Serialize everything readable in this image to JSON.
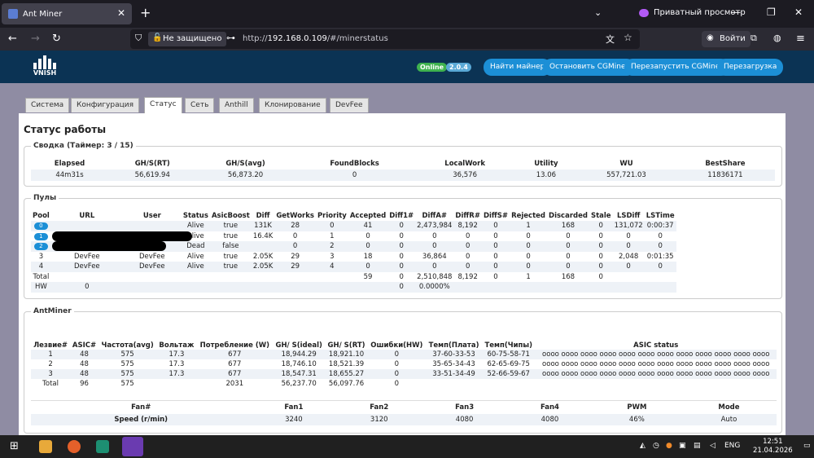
{
  "browser": {
    "tab_title": "Ant Miner",
    "private_label": "Приватный просмотр",
    "not_secure": "Не защищено",
    "url_prefix": "http://",
    "url_host": "192.168.0.109",
    "url_path": "/#/minerstatus",
    "login_label": "Войти"
  },
  "header": {
    "logo_text": "VNISH",
    "online_badge": "Online",
    "version_badge": "2.0.4",
    "buttons": [
      "Найти майнер",
      "Остановить CGMiner",
      "Перезапустить CGMiner",
      "Перезагрузка"
    ]
  },
  "tabs": [
    "Система",
    "Конфигурация",
    "Статус",
    "Сеть",
    "Anthill",
    "Клонирование",
    "DevFee"
  ],
  "page_title": "Статус работы",
  "summary": {
    "legend": "Сводка (Таймер: 3 / 15)",
    "headers": [
      "Elapsed",
      "GH/S(RT)",
      "GH/S(avg)",
      "FoundBlocks",
      "LocalWork",
      "Utility",
      "WU",
      "BestShare"
    ],
    "values": [
      "44m31s",
      "56,619.94",
      "56,873.20",
      "0",
      "36,576",
      "13.06",
      "557,721.03",
      "11836171"
    ]
  },
  "pools": {
    "legend": "Пулы",
    "headers": [
      "Pool",
      "URL",
      "User",
      "Status",
      "AsicBoost",
      "Diff",
      "GetWorks",
      "Priority",
      "Accepted",
      "Diff1#",
      "DiffA#",
      "DiffR#",
      "DiffS#",
      "Rejected",
      "Discarded",
      "Stale",
      "LSDiff",
      "LSTime"
    ],
    "rows": [
      [
        "0",
        "",
        "",
        "Alive",
        "true",
        "131K",
        "28",
        "0",
        "41",
        "0",
        "2,473,984",
        "8,192",
        "0",
        "1",
        "168",
        "0",
        "131,072",
        "0:00:37"
      ],
      [
        "1",
        "",
        "",
        "Alive",
        "true",
        "16.4K",
        "0",
        "1",
        "0",
        "0",
        "0",
        "0",
        "0",
        "0",
        "0",
        "0",
        "0",
        "0"
      ],
      [
        "2",
        "",
        "",
        "Dead",
        "false",
        "",
        "0",
        "2",
        "0",
        "0",
        "0",
        "0",
        "0",
        "0",
        "0",
        "0",
        "0",
        "0"
      ],
      [
        "3",
        "DevFee",
        "DevFee",
        "Alive",
        "true",
        "2.05K",
        "29",
        "3",
        "18",
        "0",
        "36,864",
        "0",
        "0",
        "0",
        "0",
        "0",
        "2,048",
        "0:01:35"
      ],
      [
        "4",
        "DevFee",
        "DevFee",
        "Alive",
        "true",
        "2.05K",
        "29",
        "4",
        "0",
        "0",
        "0",
        "0",
        "0",
        "0",
        "0",
        "0",
        "0",
        "0"
      ],
      [
        "Total",
        "",
        "",
        "",
        "",
        "",
        "",
        "",
        "59",
        "0",
        "2,510,848",
        "8,192",
        "0",
        "1",
        "168",
        "0",
        "",
        ""
      ],
      [
        "HW",
        "0",
        "",
        "",
        "",
        "",
        "",
        "",
        "",
        "0",
        "0.0000%",
        "",
        "",
        "",
        "",
        "",
        "",
        ""
      ]
    ]
  },
  "antminer": {
    "legend": "AntMiner",
    "headers": [
      "Лезвие#",
      "ASIC#",
      "Частота(avg)",
      "Вольтаж",
      "Потребление (W)",
      "GH/ S(ideal)",
      "GH/ S(RT)",
      "Ошибки(HW)",
      "Темп(Плата)",
      "Темп(Чипы)",
      "ASIC status"
    ],
    "rows": [
      [
        "1",
        "48",
        "575",
        "17.3",
        "677",
        "18,944.29",
        "18,921.10",
        "0",
        "37-60-33-53",
        "60-75-58-71",
        "oooo oooo oooo oooo oooo oooo oooo oooo oooo oooo oooo oooo"
      ],
      [
        "2",
        "48",
        "575",
        "17.3",
        "677",
        "18,746.10",
        "18,521.39",
        "0",
        "35-65-34-43",
        "62-65-69-75",
        "oooo oooo oooo oooo oooo oooo oooo oooo oooo oooo oooo oooo"
      ],
      [
        "3",
        "48",
        "575",
        "17.3",
        "677",
        "18,547.31",
        "18,655.27",
        "0",
        "33-51-34-49",
        "52-66-59-67",
        "oooo oooo oooo oooo oooo oooo oooo oooo oooo oooo oooo oooo"
      ],
      [
        "Total",
        "96",
        "575",
        "",
        "2031",
        "56,237.70",
        "56,097.76",
        "0",
        "",
        "",
        ""
      ]
    ]
  },
  "fans": {
    "headers": [
      "Fan#",
      "Fan1",
      "Fan2",
      "Fan3",
      "Fan4",
      "PWM",
      "Mode"
    ],
    "values": [
      "Speed (r/min)",
      "3240",
      "3120",
      "4080",
      "4080",
      "46%",
      "Auto"
    ]
  },
  "taskbar": {
    "lang": "ENG",
    "time": "12:51",
    "date": "21.04.2026"
  },
  "colors": {
    "header_bg": "#0b3354",
    "accent_button": "#1c8fd6",
    "online_badge": "#3fb24f",
    "version_badge": "#5aa9d6"
  }
}
